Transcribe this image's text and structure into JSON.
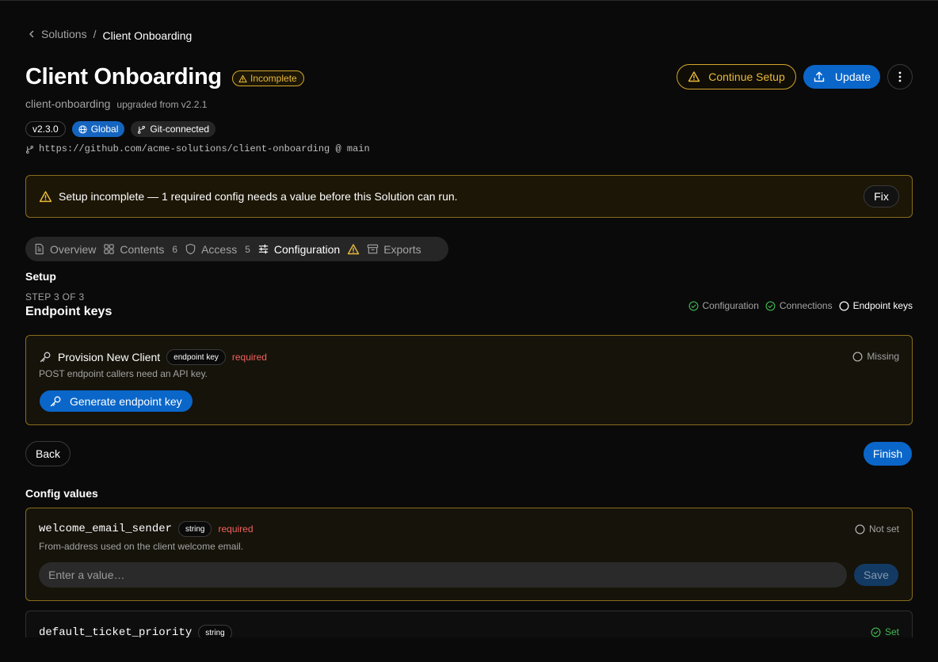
{
  "breadcrumb": {
    "parent": "Solutions",
    "current": "Client Onboarding"
  },
  "header": {
    "title": "Client Onboarding",
    "status_badge": "Incomplete",
    "slug": "client-onboarding",
    "upgraded_from": "upgraded from v2.2.1",
    "tags": {
      "version": "v2.3.0",
      "scope": "Global",
      "git": "Git-connected"
    },
    "repo": "https://github.com/acme-solutions/client-onboarding @ main",
    "actions": {
      "continue_setup": "Continue Setup",
      "update": "Update"
    }
  },
  "alert": {
    "message": "Setup incomplete — 1 required config needs a value before this Solution can run.",
    "fix_label": "Fix"
  },
  "tabs": [
    {
      "label": "Overview",
      "count": ""
    },
    {
      "label": "Contents",
      "count": "6"
    },
    {
      "label": "Access",
      "count": "5"
    },
    {
      "label": "Configuration",
      "count": ""
    },
    {
      "label": "Exports",
      "count": ""
    }
  ],
  "setup": {
    "heading": "Setup",
    "step_label": "STEP 3 OF 3",
    "step_title": "Endpoint keys",
    "steps": [
      "Configuration",
      "Connections",
      "Endpoint keys"
    ]
  },
  "endpoint_key": {
    "name": "Provision New Client",
    "type": "endpoint key",
    "required": "required",
    "description": "POST endpoint callers need an API key.",
    "status": "Missing",
    "action": "Generate endpoint key"
  },
  "nav": {
    "back": "Back",
    "finish": "Finish"
  },
  "config": {
    "heading": "Config values",
    "items": [
      {
        "key": "welcome_email_sender",
        "type": "string",
        "required": "required",
        "description": "From-address used on the client welcome email.",
        "status": "Not set",
        "placeholder": "Enter a value…",
        "save": "Save"
      },
      {
        "key": "default_ticket_priority",
        "type": "string",
        "status": "Set"
      }
    ]
  },
  "colors": {
    "background": "#0a0a0a",
    "accent_blue": "#0a66c8",
    "warning": "#e8b93a",
    "required": "#f0625e",
    "success": "#3fb950"
  }
}
